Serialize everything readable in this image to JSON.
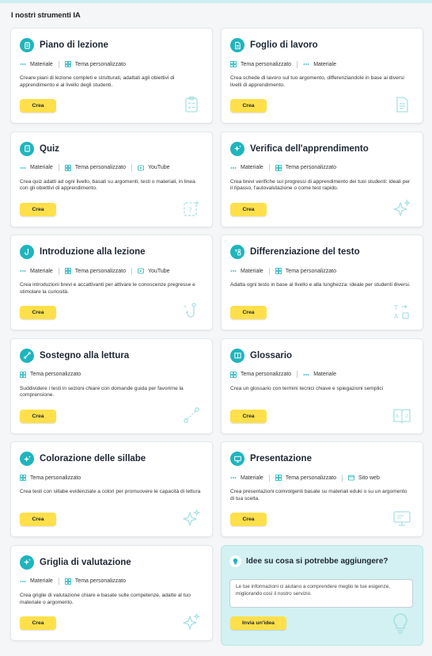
{
  "section_title": "I nostri strumenti IA",
  "colors": {
    "accent": "#1fb5bd",
    "button": "#ffe04a",
    "idea_bg": "#d3f1f2"
  },
  "cards": [
    {
      "title": "Piano di lezione",
      "icon": "clipboard-icon",
      "tags": [
        {
          "label": "Materiale",
          "icon": "dots-icon"
        },
        {
          "label": "Tema personalizzato",
          "icon": "grid-icon"
        }
      ],
      "description": "Creare piani di lezione completi e strutturati, adattati agli obiettivi di apprendimento e al livello degli studenti.",
      "button": "Crea",
      "bg_icon": "clipboard-list-icon"
    },
    {
      "title": "Foglio di lavoro",
      "icon": "document-icon",
      "tags": [
        {
          "label": "Tema personalizzato",
          "icon": "grid-icon"
        },
        {
          "label": "Materiale",
          "icon": "dots-icon"
        }
      ],
      "description": "Crea schede di lavoro sul tuo argomento, differenziandole in base ai diversi livelli di apprendimento.",
      "button": "Crea",
      "bg_icon": "document-lines-icon"
    },
    {
      "title": "Quiz",
      "icon": "quiz-icon",
      "tags": [
        {
          "label": "Materiale",
          "icon": "dots-icon"
        },
        {
          "label": "Tema personalizzato",
          "icon": "grid-icon"
        },
        {
          "label": "YouTube",
          "icon": "play-icon"
        }
      ],
      "description": "Crea quiz adatti ad ogni livello, basati su argomenti, testi o materiali, in linea con gli obiettivi di apprendimento.",
      "button": "Crea",
      "bg_icon": "question-box-icon"
    },
    {
      "title": "Verifica dell'apprendimento",
      "icon": "sparkle-icon",
      "tags": [
        {
          "label": "Materiale",
          "icon": "dots-icon"
        },
        {
          "label": "Tema personalizzato",
          "icon": "grid-icon"
        }
      ],
      "description": "Crea brevi verifiche sui progressi di apprendimento dei tuoi studenti: ideali per il ripasso, l'autovalutazione o come test rapido.",
      "button": "Crea",
      "bg_icon": "sparkles-icon"
    },
    {
      "title": "Introduzione alla lezione",
      "icon": "hook-icon",
      "tags": [
        {
          "label": "Materiale",
          "icon": "dots-icon"
        },
        {
          "label": "Tema personalizzato",
          "icon": "grid-icon"
        },
        {
          "label": "YouTube",
          "icon": "play-icon"
        }
      ],
      "description": "Crea introduzioni brevi e accattivanti per attivare le conoscenze pregresse e stimolare la curiosità.",
      "button": "Crea",
      "bg_icon": "fish-hook-icon"
    },
    {
      "title": "Differenziazione del testo",
      "icon": "text-shapes-icon",
      "tags": [
        {
          "label": "Materiale",
          "icon": "dots-icon"
        },
        {
          "label": "Tema personalizzato",
          "icon": "grid-icon"
        }
      ],
      "description": "Adatta ogni testo in base al livello e alla lunghezza: ideale per studenti diversi.",
      "button": "Crea",
      "bg_icon": "text-transform-icon"
    },
    {
      "title": "Sostegno alla lettura",
      "icon": "path-icon",
      "tags": [
        {
          "label": "Tema personalizzato",
          "icon": "grid-icon"
        }
      ],
      "description": "Suddividere i testi in sezioni chiare con domande guida per favorirne la comprensione.",
      "button": "Crea",
      "bg_icon": "route-icon"
    },
    {
      "title": "Glossario",
      "icon": "book-icon",
      "tags": [
        {
          "label": "Tema personalizzato",
          "icon": "grid-icon"
        },
        {
          "label": "Materiale",
          "icon": "dots-icon"
        }
      ],
      "description": "Crea un glossario con termini tecnici chiave e spiegazioni semplici",
      "button": "Crea",
      "bg_icon": "book-az-icon"
    },
    {
      "title": "Colorazione delle sillabe",
      "icon": "sparkle-icon",
      "tags": [
        {
          "label": "Tema personalizzato",
          "icon": "grid-icon"
        }
      ],
      "description": "Crea testi con sillabe evidenziate a colori per promuovere le capacità di lettura",
      "button": "Crea",
      "bg_icon": "sparkles-icon"
    },
    {
      "title": "Presentazione",
      "icon": "monitor-icon",
      "tags": [
        {
          "label": "Materiale",
          "icon": "dots-icon"
        },
        {
          "label": "Tema personalizzato",
          "icon": "grid-icon"
        },
        {
          "label": "Sito web",
          "icon": "browser-icon"
        }
      ],
      "description": "Crea presentazioni coinvolgenti basate su materiali eduki o su un argomento di tua scelta.",
      "button": "Crea",
      "bg_icon": "monitor-outline-icon"
    },
    {
      "title": "Griglia di valutazione",
      "icon": "sparkle-icon",
      "tags": [
        {
          "label": "Materiale",
          "icon": "dots-icon"
        },
        {
          "label": "Tema personalizzato",
          "icon": "grid-icon"
        }
      ],
      "description": "Crea griglie di valutazione chiare e basate sulle competenze, adatte al tuo materiale o argomento.",
      "button": "Crea",
      "bg_icon": "sparkles-icon"
    }
  ],
  "idea": {
    "title": "Idee su cosa si potrebbe aggiungere?",
    "placeholder": "Le tue informazioni ci aiutano a comprendere meglio le tue esigenze, migliorando così il nostro servizio.",
    "button": "Invia un'idea",
    "icon": "lightbulb-icon"
  }
}
